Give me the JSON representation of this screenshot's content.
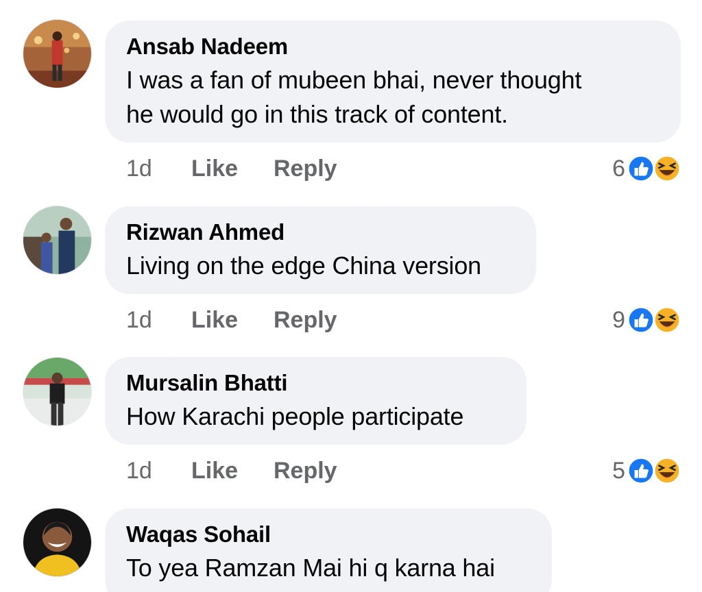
{
  "comments": [
    {
      "author": "Ansab Nadeem",
      "lines": [
        "I was a fan of mubeen bhai, never thought",
        "he would go in this track of content."
      ],
      "time": "1d",
      "like_label": "Like",
      "reply_label": "Reply",
      "reaction_count": "6",
      "reaction_icons": [
        "like-icon",
        "haha-icon"
      ]
    },
    {
      "author": "Rizwan Ahmed",
      "lines": [
        "Living on the edge China version"
      ],
      "time": "1d",
      "like_label": "Like",
      "reply_label": "Reply",
      "reaction_count": "9",
      "reaction_icons": [
        "like-icon",
        "haha-icon"
      ]
    },
    {
      "author": "Mursalin Bhatti",
      "lines": [
        "How Karachi people participate"
      ],
      "time": "1d",
      "like_label": "Like",
      "reply_label": "Reply",
      "reaction_count": "5",
      "reaction_icons": [
        "like-icon",
        "haha-icon"
      ]
    },
    {
      "author": "Waqas Sohail",
      "lines": [
        "To yea Ramzan Mai hi q karna hai"
      ]
    }
  ],
  "colors": {
    "bubble": "#f0f2f5",
    "meta_text": "#65676b",
    "like_blue": "#1877f2",
    "haha_yellow": "#f7b125"
  }
}
